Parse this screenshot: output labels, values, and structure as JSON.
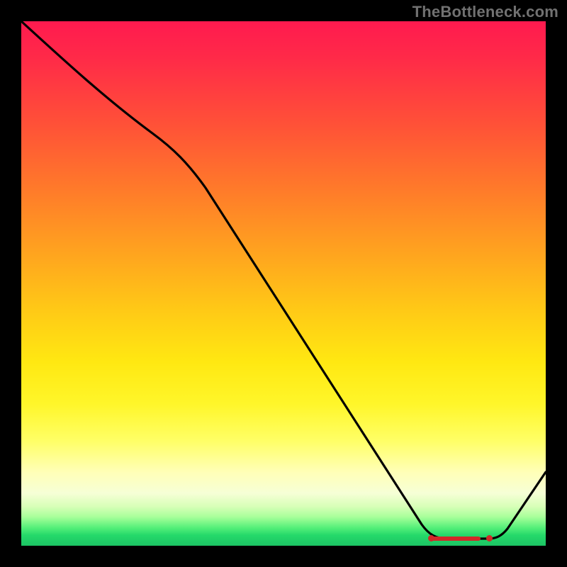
{
  "watermark": "TheBottleneck.com",
  "colors": {
    "page_bg": "#000000",
    "curve_stroke": "#000000",
    "marker": "#d22828",
    "watermark_text": "#717171"
  },
  "chart_data": {
    "type": "line",
    "title": "",
    "xlabel": "",
    "ylabel": "",
    "xlim": [
      0,
      100
    ],
    "ylim": [
      0,
      100
    ],
    "grid": false,
    "legend": false,
    "series": [
      {
        "name": "bottleneck-curve",
        "x": [
          0,
          12,
          25,
          40,
          55,
          70,
          78,
          82,
          86,
          90,
          100
        ],
        "y": [
          100,
          90,
          79,
          56,
          33,
          10,
          1.5,
          1.2,
          1.2,
          1.3,
          15
        ]
      }
    ],
    "optimal_segment": {
      "name": "optimal-range",
      "x_start": 78,
      "x_end": 90,
      "y": 1.3
    },
    "gradient_description": "vertical red-to-green heat gradient (red=100 bottleneck, green=0)"
  }
}
